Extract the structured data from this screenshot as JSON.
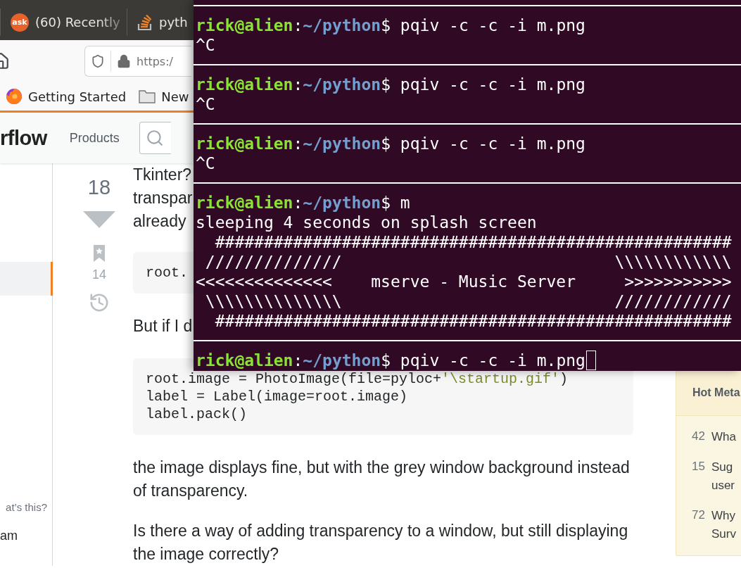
{
  "browser": {
    "tabs": [
      {
        "kind": "ask",
        "logo_text": "ask",
        "title": "(60) Recently"
      },
      {
        "kind": "stack",
        "title": "pyth"
      }
    ],
    "address": "https:/",
    "bookmarks": [
      {
        "kind": "firefox",
        "label": "Getting Started"
      },
      {
        "kind": "folder",
        "label": "New"
      }
    ]
  },
  "site": {
    "logo": "rflow",
    "nav": [
      "Products"
    ]
  },
  "left_nav": {
    "items": [
      {
        "selected": true
      }
    ],
    "notes": [
      {
        "kind": "small",
        "text": "at’s this?"
      },
      {
        "kind": "large",
        "text": "am"
      }
    ]
  },
  "question": {
    "votes": "18",
    "bookmarks": "14",
    "body": [
      {
        "kind": "cut",
        "lines": [
          "Tkinter?",
          "transpar",
          "already"
        ]
      },
      {
        "kind": "code",
        "lines": [
          [
            {
              "kind": "plain",
              "t": "root."
            }
          ]
        ]
      },
      {
        "kind": "cut",
        "lines": [
          "But if I d"
        ]
      },
      {
        "kind": "code",
        "lines": [
          [
            {
              "kind": "plain",
              "t": "root.image = PhotoImage(file=pyloc+"
            },
            {
              "kind": "string",
              "t": "'\\startup.gif'"
            },
            {
              "kind": "plain",
              "t": ")"
            }
          ],
          [
            {
              "kind": "plain",
              "t": "label = Label(image=root.image)"
            }
          ],
          [
            {
              "kind": "plain",
              "t": "label.pack()"
            }
          ]
        ]
      },
      {
        "kind": "text",
        "lines": [
          "the image displays fine, but with the grey window background instead of transparency."
        ]
      },
      {
        "kind": "text",
        "lines": [
          "Is there a way of adding transparency to a window, but still displaying the image correctly?"
        ]
      }
    ]
  },
  "hot_meta": {
    "title": "Hot Meta",
    "items": [
      {
        "count": "42",
        "lines": [
          "Wha"
        ]
      },
      {
        "count": "15",
        "lines": [
          "Sug",
          "user"
        ]
      },
      {
        "count": "72",
        "lines": [
          "Why",
          "Surv"
        ]
      }
    ]
  },
  "terminal": {
    "blocks": [
      {
        "lines": [
          {
            "kind": "prompt",
            "user": "rick@alien",
            "sep": ":",
            "path": "~/python",
            "sign": "$",
            "command": "pqiv -c -c -i m.png",
            "cursor": false
          },
          {
            "kind": "output",
            "text": "^C"
          }
        ]
      },
      {
        "lines": [
          {
            "kind": "prompt",
            "user": "rick@alien",
            "sep": ":",
            "path": "~/python",
            "sign": "$",
            "command": "pqiv -c -c -i m.png",
            "cursor": false
          },
          {
            "kind": "output",
            "text": "^C"
          }
        ]
      },
      {
        "lines": [
          {
            "kind": "prompt",
            "user": "rick@alien",
            "sep": ":",
            "path": "~/python",
            "sign": "$",
            "command": "pqiv -c -c -i m.png",
            "cursor": false
          },
          {
            "kind": "output",
            "text": "^C"
          }
        ]
      },
      {
        "lines": [
          {
            "kind": "prompt",
            "user": "rick@alien",
            "sep": ":",
            "path": "~/python",
            "sign": "$",
            "command": "m",
            "cursor": false
          },
          {
            "kind": "output",
            "text": "sleeping 4 seconds on splash screen"
          },
          {
            "kind": "output",
            "text": "  #####################################################"
          },
          {
            "kind": "output",
            "text": " //////////////                            \\\\\\\\\\\\\\\\\\\\\\\\"
          },
          {
            "kind": "output",
            "text": "<<<<<<<<<<<<<<    mserve - Music Server     >>>>>>>>>>>"
          },
          {
            "kind": "output",
            "text": " \\\\\\\\\\\\\\\\\\\\\\\\\\\\                            ////////////"
          },
          {
            "kind": "output",
            "text": "  #####################################################"
          }
        ]
      },
      {
        "lines": [
          {
            "kind": "prompt",
            "user": "rick@alien",
            "sep": ":",
            "path": "~/python",
            "sign": "$",
            "command": "pqiv -c -c -i m.png",
            "cursor": true
          }
        ]
      }
    ]
  }
}
